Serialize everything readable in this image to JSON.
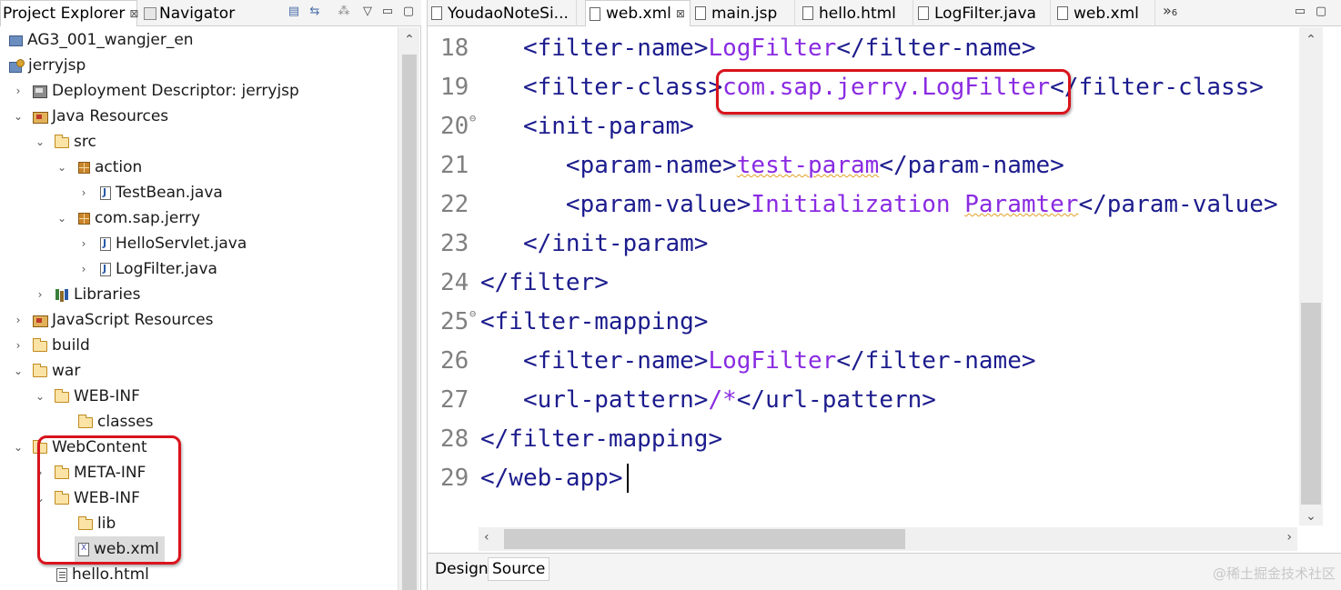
{
  "left_panel": {
    "tabs": [
      {
        "label": "Project Explorer",
        "close": "⊠"
      },
      {
        "label": "Navigator"
      }
    ],
    "toolbar_icons": [
      "collapse-all-icon",
      "link-editor-icon",
      "filter-icon",
      "view-menu-icon",
      "minimize-icon",
      "maximize-icon"
    ],
    "tree": [
      {
        "label": "AG3_001_wangjer_en",
        "icon": "project-icon",
        "twisty": ""
      },
      {
        "label": "jerryjsp",
        "icon": "web-project-icon",
        "twisty": ""
      },
      {
        "label": "Deployment Descriptor: jerryjsp",
        "icon": "deployment-descriptor-icon",
        "twisty": ">"
      },
      {
        "label": "Java Resources",
        "icon": "java-resources-icon",
        "twisty": "v"
      },
      {
        "label": "src",
        "icon": "source-folder-icon",
        "twisty": "v"
      },
      {
        "label": "action",
        "icon": "package-icon",
        "twisty": "v"
      },
      {
        "label": "TestBean.java",
        "icon": "java-file-icon",
        "twisty": ">"
      },
      {
        "label": "com.sap.jerry",
        "icon": "package-icon",
        "twisty": "v"
      },
      {
        "label": "HelloServlet.java",
        "icon": "java-file-icon",
        "twisty": ">"
      },
      {
        "label": "LogFilter.java",
        "icon": "java-file-icon",
        "twisty": ">"
      },
      {
        "label": "Libraries",
        "icon": "libraries-icon",
        "twisty": ">"
      },
      {
        "label": "JavaScript Resources",
        "icon": "javascript-resources-icon",
        "twisty": ">"
      },
      {
        "label": "build",
        "icon": "folder-icon",
        "twisty": ">"
      },
      {
        "label": "war",
        "icon": "folder-icon",
        "twisty": "v"
      },
      {
        "label": "WEB-INF",
        "icon": "folder-icon",
        "twisty": "v"
      },
      {
        "label": "classes",
        "icon": "folder-icon",
        "twisty": ""
      },
      {
        "label": "WebContent",
        "icon": "folder-icon",
        "twisty": "v"
      },
      {
        "label": "META-INF",
        "icon": "folder-icon",
        "twisty": ">"
      },
      {
        "label": "WEB-INF",
        "icon": "folder-icon",
        "twisty": "v"
      },
      {
        "label": "lib",
        "icon": "folder-icon",
        "twisty": ""
      },
      {
        "label": "web.xml",
        "icon": "xml-file-icon",
        "twisty": "",
        "selected": true
      },
      {
        "label": "hello.html",
        "icon": "html-file-icon",
        "twisty": ""
      }
    ]
  },
  "editor": {
    "tabs": [
      {
        "label": "YoudaoNoteSi..."
      },
      {
        "label": "web.xml",
        "active": true,
        "close": "⊠"
      },
      {
        "label": "main.jsp"
      },
      {
        "label": "hello.html"
      },
      {
        "label": "LogFilter.java"
      },
      {
        "label": "web.xml"
      }
    ],
    "overflow_label": "»",
    "overflow_count": "6",
    "lines": [
      {
        "num": "18",
        "fold": false,
        "segments": [
          {
            "t": "   ",
            "c": ""
          },
          {
            "t": "<filter-name>",
            "c": "tag"
          },
          {
            "t": "LogFilter",
            "c": "val"
          },
          {
            "t": "</filter-name>",
            "c": "tag"
          }
        ]
      },
      {
        "num": "19",
        "fold": false,
        "segments": [
          {
            "t": "   ",
            "c": ""
          },
          {
            "t": "<filter-class>",
            "c": "tag"
          },
          {
            "t": "com.sap.jerry.LogFilter",
            "c": "val"
          },
          {
            "t": "</filter-class>",
            "c": "tag"
          }
        ]
      },
      {
        "num": "20",
        "fold": true,
        "segments": [
          {
            "t": "   ",
            "c": ""
          },
          {
            "t": "<init-param>",
            "c": "tag"
          }
        ]
      },
      {
        "num": "21",
        "fold": false,
        "segments": [
          {
            "t": "      ",
            "c": ""
          },
          {
            "t": "<param-name>",
            "c": "tag"
          },
          {
            "t": "test-param",
            "c": "val squig"
          },
          {
            "t": "</param-name>",
            "c": "tag"
          }
        ]
      },
      {
        "num": "22",
        "fold": false,
        "segments": [
          {
            "t": "      ",
            "c": ""
          },
          {
            "t": "<param-value>",
            "c": "tag"
          },
          {
            "t": "Initialization ",
            "c": "val"
          },
          {
            "t": "Paramter",
            "c": "val squig"
          },
          {
            "t": "</param-value>",
            "c": "tag"
          }
        ]
      },
      {
        "num": "23",
        "fold": false,
        "segments": [
          {
            "t": "   ",
            "c": ""
          },
          {
            "t": "</init-param>",
            "c": "tag"
          }
        ]
      },
      {
        "num": "24",
        "fold": false,
        "segments": [
          {
            "t": "</filter>",
            "c": "tag"
          }
        ]
      },
      {
        "num": "25",
        "fold": true,
        "segments": [
          {
            "t": "<filter-mapping>",
            "c": "tag"
          }
        ]
      },
      {
        "num": "26",
        "fold": false,
        "segments": [
          {
            "t": "   ",
            "c": ""
          },
          {
            "t": "<filter-name>",
            "c": "tag"
          },
          {
            "t": "LogFilter",
            "c": "val"
          },
          {
            "t": "</filter-name>",
            "c": "tag"
          }
        ]
      },
      {
        "num": "27",
        "fold": false,
        "segments": [
          {
            "t": "   ",
            "c": ""
          },
          {
            "t": "<url-pattern>",
            "c": "tag"
          },
          {
            "t": "/*",
            "c": "val"
          },
          {
            "t": "</url-pattern>",
            "c": "tag"
          }
        ]
      },
      {
        "num": "28",
        "fold": false,
        "segments": [
          {
            "t": "</filter-mapping>",
            "c": "tag"
          }
        ]
      },
      {
        "num": "29",
        "fold": false,
        "segments": [
          {
            "t": "</web-app>",
            "c": "tag"
          }
        ]
      }
    ],
    "bottom_tabs": [
      {
        "label": "Design"
      },
      {
        "label": "Source",
        "active": true
      }
    ]
  },
  "watermark": "@稀土掘金技术社区",
  "colors": {
    "tag": "#1c1c8e",
    "value": "#8a2be2",
    "highlight": "#d9131c",
    "line_number": "#808080"
  }
}
